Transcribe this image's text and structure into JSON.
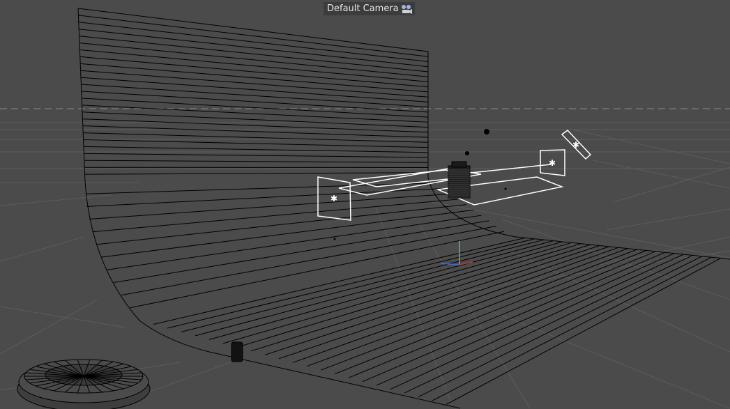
{
  "viewport": {
    "camera_label": "Default Camera",
    "camera_icon": "camera-icon",
    "background_color": "#4b4b4b",
    "wireframe_color": "#000000",
    "selection_color": "#ffffff",
    "axis_colors": {
      "x": "#c0392b",
      "y": "#2ecc71",
      "z": "#3a6fd8"
    }
  }
}
